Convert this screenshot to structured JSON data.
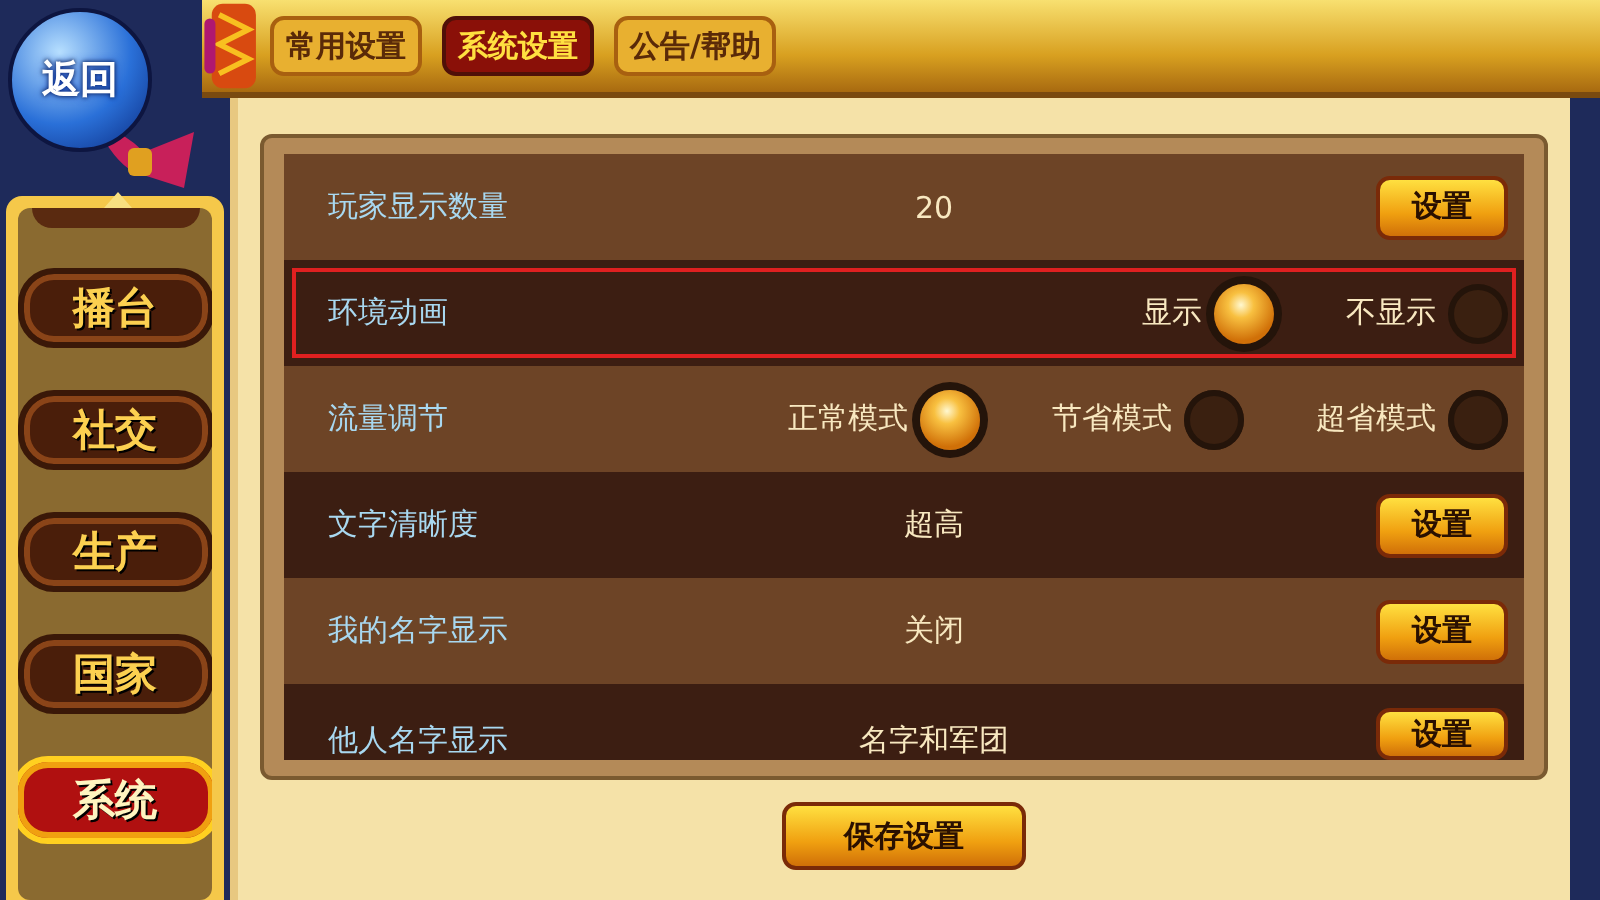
{
  "back_button": {
    "label": "返回"
  },
  "tabs": [
    {
      "label": "常用设置",
      "selected": false
    },
    {
      "label": "系统设置",
      "selected": true
    },
    {
      "label": "公告/帮助",
      "selected": false
    }
  ],
  "sidebar": {
    "items": [
      {
        "label": "播台",
        "selected": false
      },
      {
        "label": "社交",
        "selected": false
      },
      {
        "label": "生产",
        "selected": false
      },
      {
        "label": "国家",
        "selected": false
      },
      {
        "label": "系统",
        "selected": true
      }
    ]
  },
  "settings": [
    {
      "kind": "button",
      "label": "玩家显示数量",
      "value": "20",
      "button": "设置",
      "highlighted": false
    },
    {
      "kind": "radio",
      "label": "环境动画",
      "highlighted": true,
      "options": [
        {
          "label": "显示",
          "selected": true
        },
        {
          "label": "不显示",
          "selected": false
        }
      ]
    },
    {
      "kind": "radio",
      "label": "流量调节",
      "highlighted": false,
      "options": [
        {
          "label": "正常模式",
          "selected": true
        },
        {
          "label": "节省模式",
          "selected": false
        },
        {
          "label": "超省模式",
          "selected": false
        }
      ]
    },
    {
      "kind": "button",
      "label": "文字清晰度",
      "value": "超高",
      "button": "设置",
      "highlighted": false
    },
    {
      "kind": "button",
      "label": "我的名字显示",
      "value": "关闭",
      "button": "设置",
      "highlighted": false
    },
    {
      "kind": "button",
      "label": "他人名字显示",
      "value": "名字和军团",
      "button": "设置",
      "highlighted": false
    }
  ],
  "save_button": {
    "label": "保存设置"
  }
}
